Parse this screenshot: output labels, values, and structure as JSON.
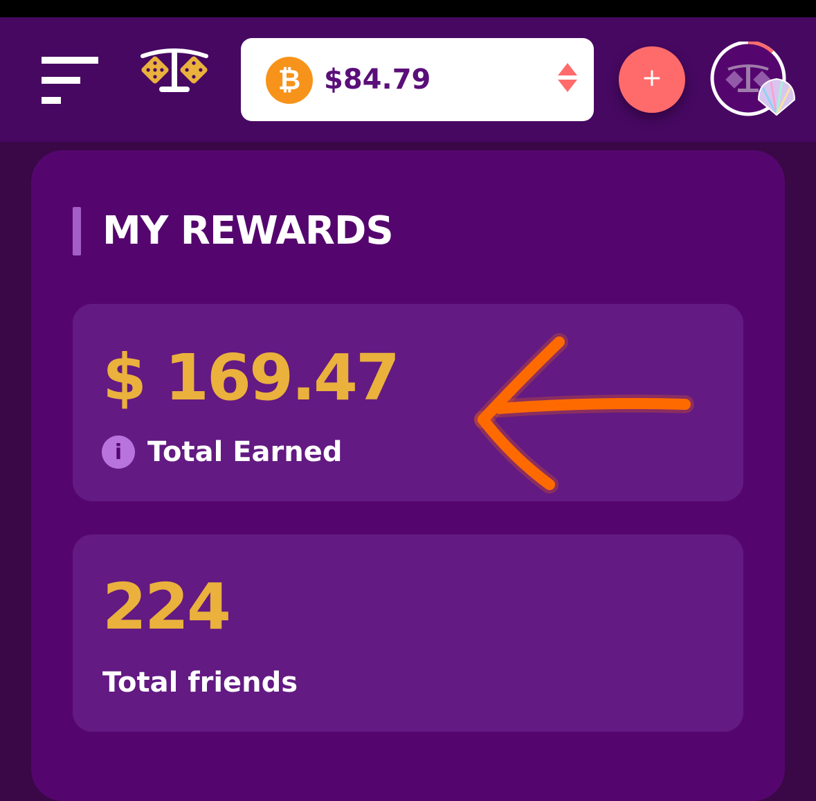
{
  "wallet": {
    "currency_icon": "bitcoin-icon",
    "amount": "$84.79"
  },
  "header": {
    "add_label": "+",
    "menu_icon": "menu-icon",
    "logo_icon": "scales-dice-logo",
    "avatar_icon": "profile-avatar"
  },
  "rewards": {
    "title": "MY REWARDS",
    "total_earned_value": "$ 169.47",
    "total_earned_label": "Total Earned",
    "info_icon": "info-icon",
    "total_friends_value": "224",
    "total_friends_label": "Total friends"
  },
  "colors": {
    "accent_gold": "#eab13d",
    "header_purple": "#470862",
    "card_purple": "#55066e",
    "add_button_red": "#ff6b6b",
    "annotation_orange": "#ff6a00"
  }
}
